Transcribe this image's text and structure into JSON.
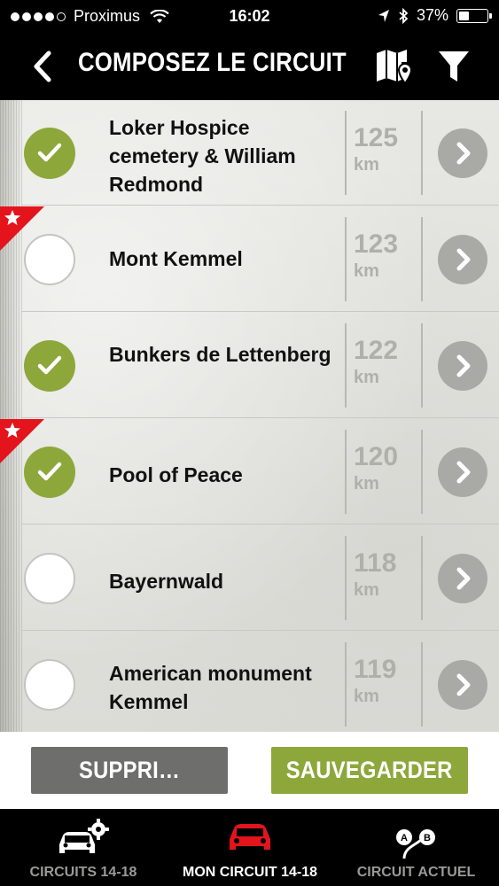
{
  "status_bar": {
    "carrier": "Proximus",
    "time": "16:02",
    "battery": "37%",
    "battery_level": 0.37
  },
  "nav": {
    "title": "COMPOSEZ LE CIRCUIT",
    "back_icon": "chevron-left-icon",
    "map_icon": "map-pin-icon",
    "filter_icon": "filter-icon"
  },
  "colors": {
    "accent_green": "#8ea73b",
    "flag_red": "#e3141c",
    "delete_gray": "#6e6e6c",
    "active_tab_red": "#e3141c"
  },
  "list": {
    "items": [
      {
        "title": "Loker Hospice cemetery & William Redmond",
        "distance": "125",
        "unit": "km",
        "checked": true,
        "starred": false
      },
      {
        "title": "Mont Kemmel",
        "distance": "123",
        "unit": "km",
        "checked": false,
        "starred": true
      },
      {
        "title": "Bunkers de Lettenberg",
        "distance": "122",
        "unit": "km",
        "checked": true,
        "starred": false
      },
      {
        "title": "Pool of Peace",
        "distance": "120",
        "unit": "km",
        "checked": true,
        "starred": true
      },
      {
        "title": "Bayernwald",
        "distance": "118",
        "unit": "km",
        "checked": false,
        "starred": false
      },
      {
        "title": "American monument Kemmel",
        "distance": "119",
        "unit": "km",
        "checked": false,
        "starred": false
      }
    ]
  },
  "actions": {
    "delete_label": "SUPPRI…ECTION",
    "save_label": "SAUVEGARDER"
  },
  "tabs": [
    {
      "label": "CIRCUITS 14-18",
      "icon": "car-gear-icon",
      "active": false
    },
    {
      "label": "MON CIRCUIT 14-18",
      "icon": "car-icon",
      "active": true
    },
    {
      "label": "CIRCUIT ACTUEL",
      "icon": "route-ab-icon",
      "active": false
    }
  ]
}
